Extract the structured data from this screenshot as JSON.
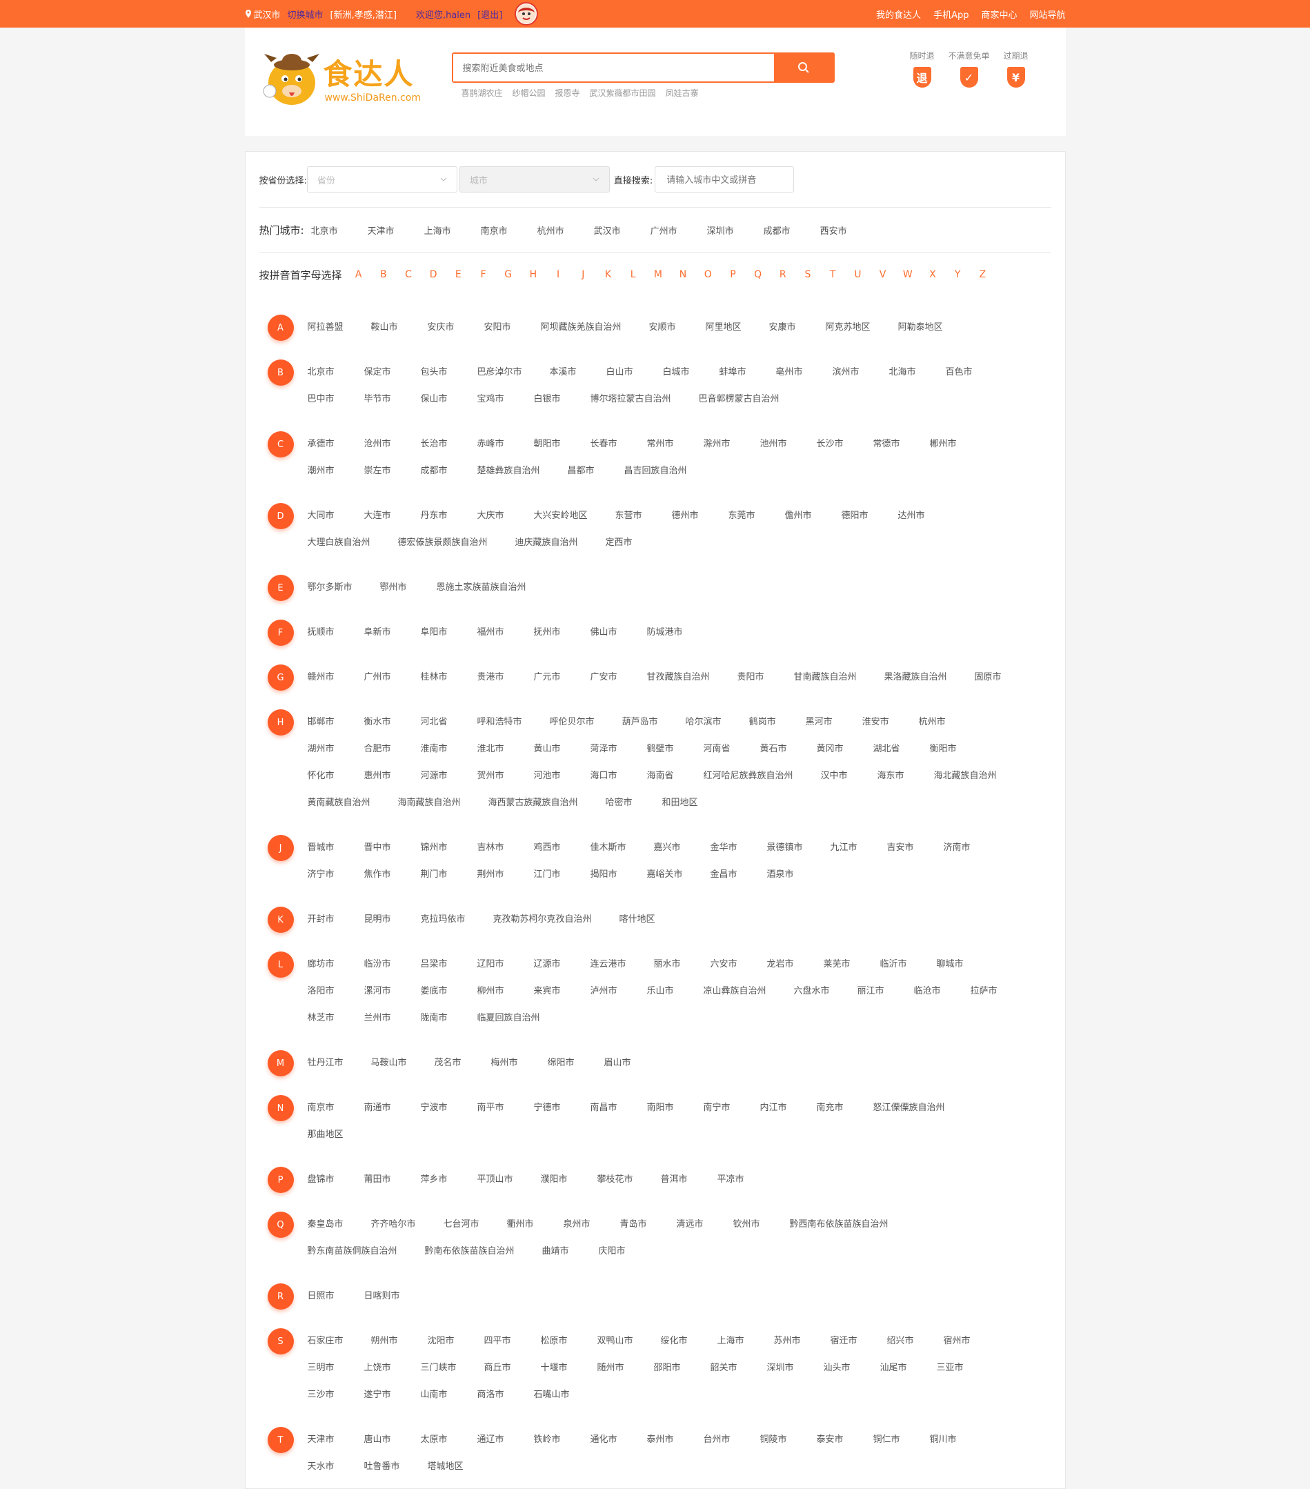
{
  "topbar": {
    "location": "武汉市",
    "switch_city": "切换城市",
    "nearby": "[新洲,孝感,潜江]",
    "welcome": "欢迎您,halen",
    "logout": "[退出]",
    "links": [
      "我的食达人",
      "手机App",
      "商家中心",
      "网站导航"
    ]
  },
  "header": {
    "brand": "食达人",
    "site": "www.ShiDaRen.com",
    "search_placeholder": "搜索附近美食或地点",
    "hot_keywords": [
      "喜鹊湖农庄",
      "纱帽公园",
      "报恩寺",
      "武汉紫薇都市田园",
      "凤娃古寨"
    ],
    "guarantees": [
      {
        "label": "随时退",
        "badge": "退"
      },
      {
        "label": "不满意免单",
        "badge": "✓"
      },
      {
        "label": "过期退",
        "badge": "¥"
      }
    ]
  },
  "filter": {
    "province_label": "按省份选择:",
    "province_placeholder": "省份",
    "city_placeholder": "城市",
    "direct_label": "直接搜索:",
    "direct_placeholder": "请输入城市中文或拼音"
  },
  "hot": {
    "label": "热门城市:",
    "cities": [
      "北京市",
      "天津市",
      "上海市",
      "南京市",
      "杭州市",
      "武汉市",
      "广州市",
      "深圳市",
      "成都市",
      "西安市"
    ]
  },
  "alpha": {
    "label": "按拼音首字母选择",
    "letters": [
      "A",
      "B",
      "C",
      "D",
      "E",
      "F",
      "G",
      "H",
      "I",
      "J",
      "K",
      "L",
      "M",
      "N",
      "O",
      "P",
      "Q",
      "R",
      "S",
      "T",
      "U",
      "V",
      "W",
      "X",
      "Y",
      "Z"
    ]
  },
  "groups": [
    {
      "letter": "A",
      "cities": [
        "阿拉善盟",
        "鞍山市",
        "安庆市",
        "安阳市",
        "阿坝藏族羌族自治州",
        "安顺市",
        "阿里地区",
        "安康市",
        "阿克苏地区",
        "阿勒泰地区"
      ]
    },
    {
      "letter": "B",
      "cities": [
        "北京市",
        "保定市",
        "包头市",
        "巴彦淖尔市",
        "本溪市",
        "白山市",
        "白城市",
        "蚌埠市",
        "亳州市",
        "滨州市",
        "北海市",
        "百色市",
        "巴中市",
        "毕节市",
        "保山市",
        "宝鸡市",
        "白银市",
        "博尔塔拉蒙古自治州",
        "巴音郭楞蒙古自治州"
      ]
    },
    {
      "letter": "C",
      "cities": [
        "承德市",
        "沧州市",
        "长治市",
        "赤峰市",
        "朝阳市",
        "长春市",
        "常州市",
        "滁州市",
        "池州市",
        "长沙市",
        "常德市",
        "郴州市",
        "潮州市",
        "崇左市",
        "成都市",
        "楚雄彝族自治州",
        "昌都市",
        "昌吉回族自治州"
      ]
    },
    {
      "letter": "D",
      "cities": [
        "大同市",
        "大连市",
        "丹东市",
        "大庆市",
        "大兴安岭地区",
        "东营市",
        "德州市",
        "东莞市",
        "儋州市",
        "德阳市",
        "达州市",
        "大理白族自治州",
        "德宏傣族景颇族自治州",
        "迪庆藏族自治州",
        "定西市"
      ]
    },
    {
      "letter": "E",
      "cities": [
        "鄂尔多斯市",
        "鄂州市",
        "恩施土家族苗族自治州"
      ]
    },
    {
      "letter": "F",
      "cities": [
        "抚顺市",
        "阜新市",
        "阜阳市",
        "福州市",
        "抚州市",
        "佛山市",
        "防城港市"
      ]
    },
    {
      "letter": "G",
      "cities": [
        "赣州市",
        "广州市",
        "桂林市",
        "贵港市",
        "广元市",
        "广安市",
        "甘孜藏族自治州",
        "贵阳市",
        "甘南藏族自治州",
        "果洛藏族自治州",
        "固原市"
      ]
    },
    {
      "letter": "H",
      "cities": [
        "邯郸市",
        "衡水市",
        "河北省",
        "呼和浩特市",
        "呼伦贝尔市",
        "葫芦岛市",
        "哈尔滨市",
        "鹤岗市",
        "黑河市",
        "淮安市",
        "杭州市",
        "湖州市",
        "合肥市",
        "淮南市",
        "淮北市",
        "黄山市",
        "菏泽市",
        "鹤壁市",
        "河南省",
        "黄石市",
        "黄冈市",
        "湖北省",
        "衡阳市",
        "怀化市",
        "惠州市",
        "河源市",
        "贺州市",
        "河池市",
        "海口市",
        "海南省",
        "红河哈尼族彝族自治州",
        "汉中市",
        "海东市",
        "海北藏族自治州",
        "黄南藏族自治州",
        "海南藏族自治州",
        "海西蒙古族藏族自治州",
        "哈密市",
        "和田地区"
      ]
    },
    {
      "letter": "J",
      "cities": [
        "晋城市",
        "晋中市",
        "锦州市",
        "吉林市",
        "鸡西市",
        "佳木斯市",
        "嘉兴市",
        "金华市",
        "景德镇市",
        "九江市",
        "吉安市",
        "济南市",
        "济宁市",
        "焦作市",
        "荆门市",
        "荆州市",
        "江门市",
        "揭阳市",
        "嘉峪关市",
        "金昌市",
        "酒泉市"
      ]
    },
    {
      "letter": "K",
      "cities": [
        "开封市",
        "昆明市",
        "克拉玛依市",
        "克孜勒苏柯尔克孜自治州",
        "喀什地区"
      ]
    },
    {
      "letter": "L",
      "cities": [
        "廊坊市",
        "临汾市",
        "吕梁市",
        "辽阳市",
        "辽源市",
        "连云港市",
        "丽水市",
        "六安市",
        "龙岩市",
        "莱芜市",
        "临沂市",
        "聊城市",
        "洛阳市",
        "漯河市",
        "娄底市",
        "柳州市",
        "来宾市",
        "泸州市",
        "乐山市",
        "凉山彝族自治州",
        "六盘水市",
        "丽江市",
        "临沧市",
        "拉萨市",
        "林芝市",
        "兰州市",
        "陇南市",
        "临夏回族自治州"
      ]
    },
    {
      "letter": "M",
      "cities": [
        "牡丹江市",
        "马鞍山市",
        "茂名市",
        "梅州市",
        "绵阳市",
        "眉山市"
      ]
    },
    {
      "letter": "N",
      "cities": [
        "南京市",
        "南通市",
        "宁波市",
        "南平市",
        "宁德市",
        "南昌市",
        "南阳市",
        "南宁市",
        "内江市",
        "南充市",
        "怒江傈僳族自治州",
        "那曲地区"
      ]
    },
    {
      "letter": "P",
      "cities": [
        "盘锦市",
        "莆田市",
        "萍乡市",
        "平顶山市",
        "濮阳市",
        "攀枝花市",
        "普洱市",
        "平凉市"
      ]
    },
    {
      "letter": "Q",
      "cities": [
        "秦皇岛市",
        "齐齐哈尔市",
        "七台河市",
        "衢州市",
        "泉州市",
        "青岛市",
        "清远市",
        "钦州市",
        "黔西南布依族苗族自治州",
        "黔东南苗族侗族自治州",
        "黔南布依族苗族自治州",
        "曲靖市",
        "庆阳市"
      ]
    },
    {
      "letter": "R",
      "cities": [
        "日照市",
        "日喀则市"
      ]
    },
    {
      "letter": "S",
      "cities": [
        "石家庄市",
        "朔州市",
        "沈阳市",
        "四平市",
        "松原市",
        "双鸭山市",
        "绥化市",
        "上海市",
        "苏州市",
        "宿迁市",
        "绍兴市",
        "宿州市",
        "三明市",
        "上饶市",
        "三门峡市",
        "商丘市",
        "十堰市",
        "随州市",
        "邵阳市",
        "韶关市",
        "深圳市",
        "汕头市",
        "汕尾市",
        "三亚市",
        "三沙市",
        "遂宁市",
        "山南市",
        "商洛市",
        "石嘴山市"
      ]
    },
    {
      "letter": "T",
      "cities": [
        "天津市",
        "唐山市",
        "太原市",
        "通辽市",
        "铁岭市",
        "通化市",
        "泰州市",
        "台州市",
        "铜陵市",
        "泰安市",
        "铜仁市",
        "铜川市",
        "天水市",
        "吐鲁番市",
        "塔城地区"
      ]
    }
  ],
  "colors": {
    "accent": "#fd6d2e",
    "link": "#4f2a9c"
  }
}
